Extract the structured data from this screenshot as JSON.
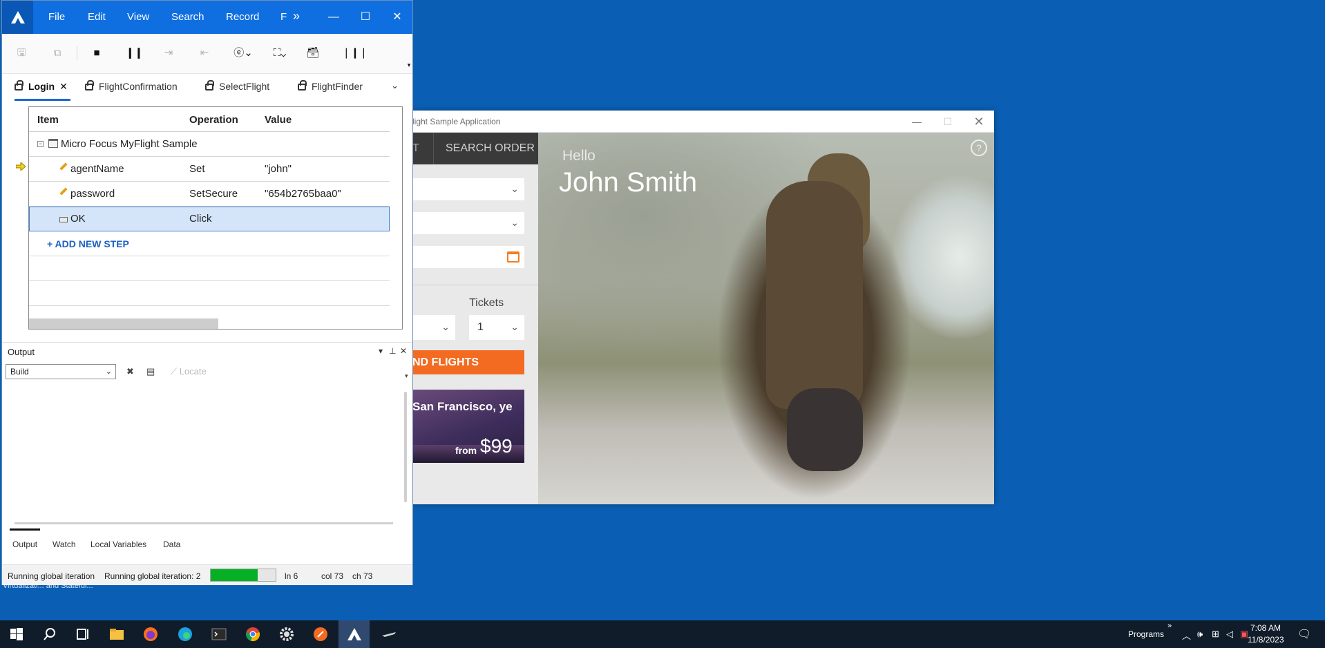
{
  "desktop": {
    "label": "Virtualizati...   and Stateful..."
  },
  "flight_app": {
    "title": "light Sample Application",
    "tab_partial": "T",
    "tab_search": "SEARCH ORDER",
    "tickets_label": "Tickets",
    "tickets_value": "1",
    "find_button": "ND FLIGHTS",
    "promo_text": "San Francisco, ye",
    "promo_from": "from",
    "promo_price": "$99",
    "greeting": "Hello",
    "user_name": "John Smith",
    "help_glyph": "?"
  },
  "uft": {
    "menu": {
      "file": "File",
      "edit": "Edit",
      "view": "View",
      "search": "Search",
      "record": "Record",
      "truncated": "F",
      "overflow": "»"
    },
    "doc_tabs": [
      {
        "label": "Login"
      },
      {
        "label": "FlightConfirmation"
      },
      {
        "label": "SelectFlight"
      },
      {
        "label": "FlightFinder"
      }
    ],
    "grid": {
      "columns": {
        "item": "Item",
        "operation": "Operation",
        "value": "Value"
      },
      "rows": [
        {
          "item": "Micro Focus MyFlight Sample",
          "operation": "",
          "value": ""
        },
        {
          "item": "agentName",
          "operation": "Set",
          "value": "\"john\""
        },
        {
          "item": "password",
          "operation": "SetSecure",
          "value": "\"654b2765baa0\""
        },
        {
          "item": "OK",
          "operation": "Click",
          "value": ""
        }
      ],
      "add_step": "+ ADD NEW STEP"
    },
    "output": {
      "title": "Output",
      "select_value": "Build",
      "locate_label": "Locate"
    },
    "bottom_tabs": {
      "output": "Output",
      "watch": "Watch",
      "locals": "Local Variables",
      "data": "Data"
    },
    "status": {
      "left": "Running global iteration",
      "mid": "Running global iteration: 2",
      "progress_fraction": 0.72,
      "ln": "ln 6",
      "col": "col 73",
      "ch": "ch 73"
    }
  },
  "taskbar": {
    "programs": "Programs",
    "overflow": "»",
    "time": "7:08 AM",
    "date": "11/8/2023",
    "colors": {
      "accent": "#0f6fe0",
      "progress": "#06b025",
      "find": "#f26b21"
    }
  }
}
